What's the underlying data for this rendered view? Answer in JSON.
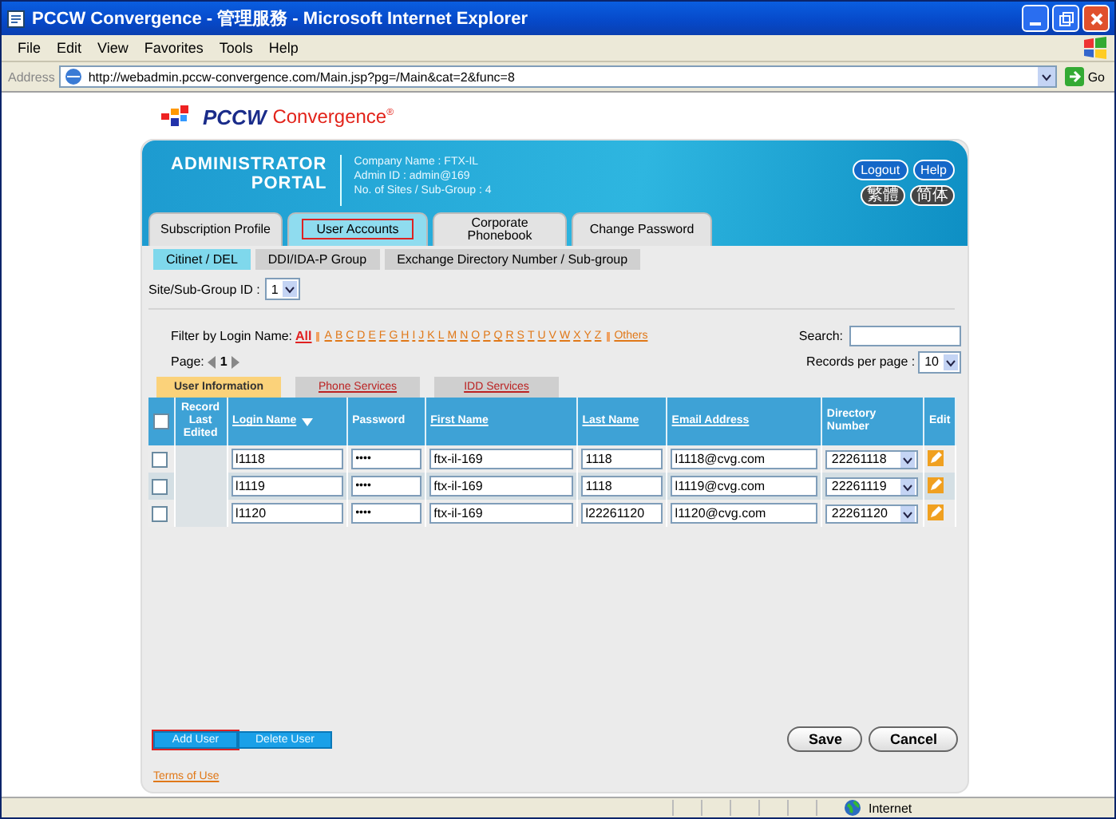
{
  "window": {
    "title": "PCCW Convergence - 管理服務 - Microsoft Internet Explorer"
  },
  "menu": [
    "File",
    "Edit",
    "View",
    "Favorites",
    "Tools",
    "Help"
  ],
  "address": {
    "label": "Address",
    "url": "http://webadmin.pccw-convergence.com/Main.jsp?pg=/Main&cat=2&func=8",
    "go": "Go"
  },
  "logo": {
    "brand": "PCCW",
    "product": "Convergence",
    "mark": "®"
  },
  "portal": {
    "title_1": "ADMINISTRATOR",
    "title_2": "PORTAL",
    "info": [
      "Company Name : FTX-IL",
      "Admin ID : admin@169",
      "No. of Sites / Sub-Group : 4"
    ],
    "buttons": [
      "Logout",
      "Help"
    ],
    "languages": [
      "繁體",
      "简体"
    ]
  },
  "tabs": [
    {
      "label": "Subscription Profile",
      "selected": false,
      "highlighted": false
    },
    {
      "label": "User Accounts",
      "selected": true,
      "highlighted": true
    },
    {
      "label": "Corporate Phonebook",
      "selected": false,
      "highlighted": false
    },
    {
      "label": "Change Password",
      "selected": false,
      "highlighted": false
    }
  ],
  "subtabs": [
    {
      "label": "Citinet / DEL",
      "selected": true
    },
    {
      "label": "DDI/IDA-P Group",
      "selected": false
    },
    {
      "label": "Exchange Directory Number / Sub-group",
      "selected": false
    }
  ],
  "site_group": {
    "label": "Site/Sub-Group ID :",
    "value": "1"
  },
  "filter": {
    "label": "Filter by Login Name:",
    "options": [
      {
        "label": "All",
        "selected": true
      },
      {
        "label": "A",
        "selected": false
      },
      {
        "label": "B",
        "selected": false
      },
      {
        "label": "C",
        "selected": false
      },
      {
        "label": "D",
        "selected": false
      },
      {
        "label": "E",
        "selected": false
      },
      {
        "label": "F",
        "selected": false
      },
      {
        "label": "G",
        "selected": false
      },
      {
        "label": "H",
        "selected": false
      },
      {
        "label": "I",
        "selected": false
      },
      {
        "label": "J",
        "selected": false
      },
      {
        "label": "K",
        "selected": false
      },
      {
        "label": "L",
        "selected": false
      },
      {
        "label": "M",
        "selected": false
      },
      {
        "label": "N",
        "selected": false
      },
      {
        "label": "O",
        "selected": false
      },
      {
        "label": "P",
        "selected": false
      },
      {
        "label": "Q",
        "selected": false
      },
      {
        "label": "R",
        "selected": false
      },
      {
        "label": "S",
        "selected": false
      },
      {
        "label": "T",
        "selected": false
      },
      {
        "label": "U",
        "selected": false
      },
      {
        "label": "V",
        "selected": false
      },
      {
        "label": "W",
        "selected": false
      },
      {
        "label": "X",
        "selected": false
      },
      {
        "label": "Y",
        "selected": false
      },
      {
        "label": "Z",
        "selected": false
      },
      {
        "label": "Others",
        "selected": false
      }
    ]
  },
  "pager": {
    "label": "Page:",
    "page": "1"
  },
  "search": {
    "label": "Search:"
  },
  "records_per_page": {
    "label": "Records per page :",
    "value": "10"
  },
  "info_tabs": [
    {
      "label": "User Information",
      "selected": true
    },
    {
      "label": "Phone Services",
      "selected": false
    },
    {
      "label": "IDD Services",
      "selected": false
    }
  ],
  "table": {
    "select_all_checked": false,
    "columns": [
      {
        "label": "Record Last Edited",
        "link": false,
        "sorted": false
      },
      {
        "label": "Login Name",
        "link": true,
        "sorted": true
      },
      {
        "label": "Password",
        "link": false,
        "sorted": false
      },
      {
        "label": "First Name",
        "link": true,
        "sorted": false
      },
      {
        "label": "Last Name",
        "link": true,
        "sorted": false
      },
      {
        "label": "Email Address",
        "link": true,
        "sorted": false
      },
      {
        "label": "Directory Number",
        "link": false,
        "sorted": false
      },
      {
        "label": "Edit",
        "link": false,
        "sorted": false
      }
    ],
    "rows": [
      {
        "checked": false,
        "login": "l1118",
        "password": "••••",
        "first": "ftx-il-169",
        "last": "1118",
        "email": "l1118@cvg.com",
        "number": "22261118"
      },
      {
        "checked": false,
        "login": "l1119",
        "password": "••••",
        "first": "ftx-il-169",
        "last": "1118",
        "email": "l1119@cvg.com",
        "number": "22261119"
      },
      {
        "checked": false,
        "login": "l1120",
        "password": "••••",
        "first": "ftx-il-169",
        "last": "l22261120",
        "email": "l1120@cvg.com",
        "number": "22261120"
      }
    ]
  },
  "actions": [
    {
      "label": "Add User",
      "highlighted": true
    },
    {
      "label": "Delete User",
      "highlighted": false
    }
  ],
  "form_buttons": [
    "Save",
    "Cancel"
  ],
  "terms": "Terms of Use",
  "status_bar": {
    "zone": "Internet"
  }
}
